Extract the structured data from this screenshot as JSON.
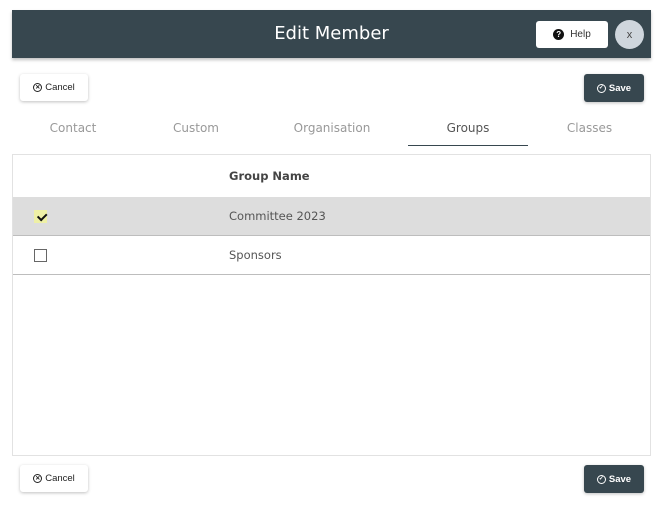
{
  "header": {
    "title": "Edit Member",
    "help_label": "Help",
    "help_icon": "question-circle-icon",
    "close_label": "x"
  },
  "actions": {
    "cancel_label": "Cancel",
    "cancel_icon": "x-circle-icon",
    "save_label": "Save",
    "save_icon": "check-circle-icon"
  },
  "tabs": [
    {
      "label": "Contact",
      "active": false
    },
    {
      "label": "Custom",
      "active": false
    },
    {
      "label": "Organisation",
      "active": false
    },
    {
      "label": "Groups",
      "active": true
    },
    {
      "label": "Classes",
      "active": false
    }
  ],
  "table": {
    "columns": [
      "",
      "Group Name"
    ],
    "rows": [
      {
        "name": "Committee 2023",
        "checked": true
      },
      {
        "name": "Sponsors",
        "checked": false
      }
    ]
  },
  "colors": {
    "header_bg": "#37474f",
    "save_bg": "#37474f",
    "selected_row": "#dddddd",
    "checked_box": "#eef0a6"
  }
}
